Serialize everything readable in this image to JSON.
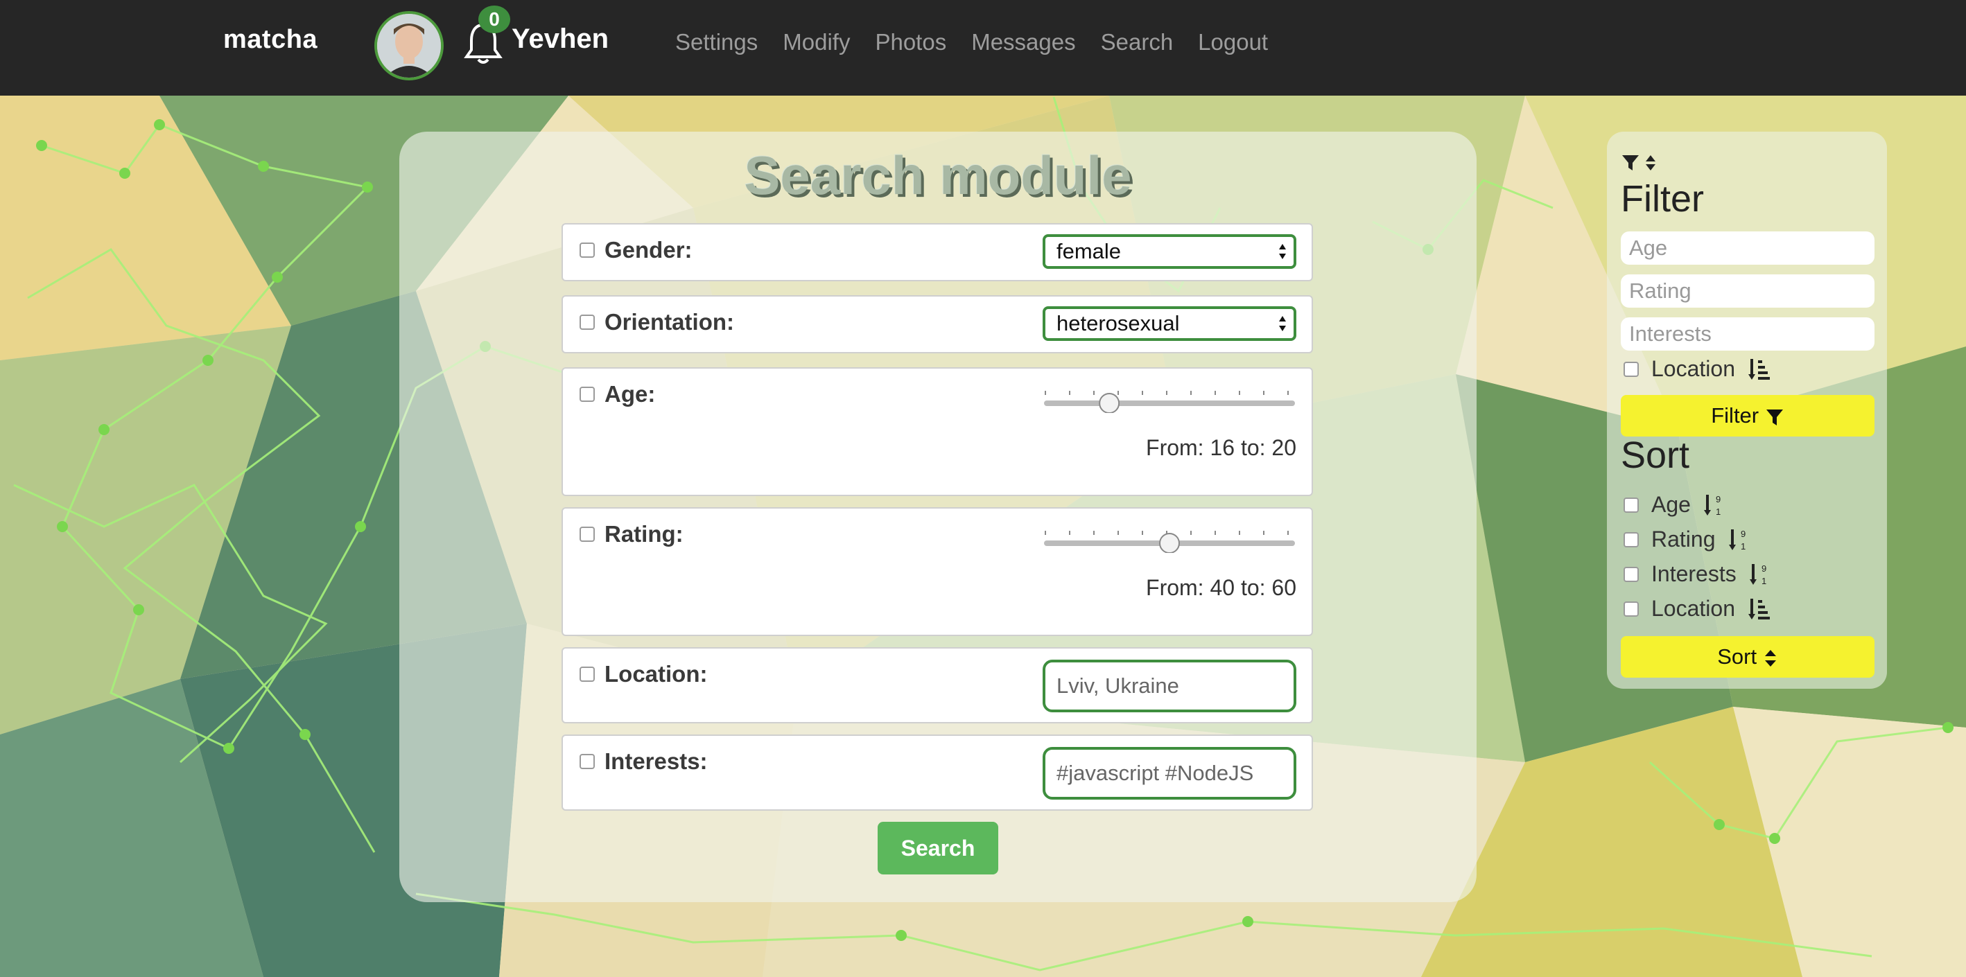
{
  "navbar": {
    "brand": "matcha",
    "notification_count": "0",
    "username": "Yevhen",
    "links": [
      "Settings",
      "Modify",
      "Photos",
      "Messages",
      "Search",
      "Logout"
    ]
  },
  "search": {
    "title": "Search module",
    "gender": {
      "label": "Gender:",
      "value": "female"
    },
    "orientation": {
      "label": "Orientation:",
      "value": "heterosexual"
    },
    "age": {
      "label": "Age:",
      "range_text": "From: 16 to: 20",
      "slider_level": 0.24
    },
    "rating": {
      "label": "Rating:",
      "range_text": "From: 40 to: 60",
      "slider_level": 0.5
    },
    "location": {
      "label": "Location:",
      "placeholder": "Lviv, Ukraine"
    },
    "interests": {
      "label": "Interests:",
      "placeholder": "#javascript #NodeJS"
    },
    "button": "Search"
  },
  "sidebar": {
    "filter_heading": "Filter",
    "age_placeholder": "Age",
    "rating_placeholder": "Rating",
    "interests_placeholder": "Interests",
    "location_label": "Location",
    "filter_button": "Filter",
    "sort_heading": "Sort",
    "sort_options": [
      "Age",
      "Rating",
      "Interests",
      "Location"
    ],
    "sort_button": "Sort"
  },
  "colors": {
    "navbar_bg": "#262626",
    "accent_green": "#3e8e3e",
    "search_button": "#5cb85c",
    "sidebar_button": "#f5f22f"
  }
}
